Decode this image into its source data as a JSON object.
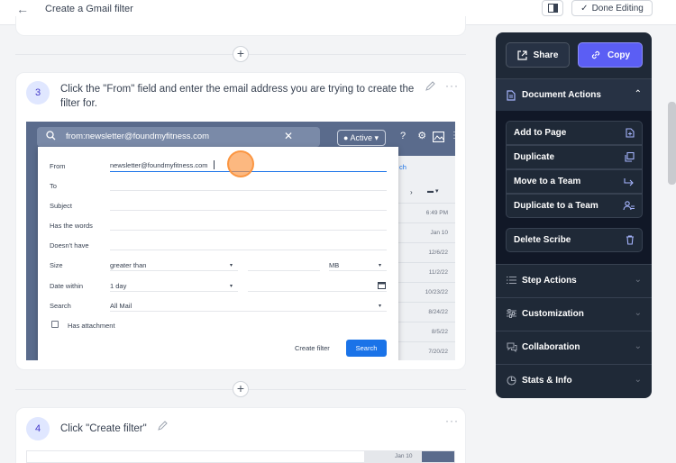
{
  "header": {
    "back_icon": "arrow-left-icon",
    "title": "Create a Gmail filter",
    "done_label": "Done Editing"
  },
  "steps": [
    {
      "number": "3",
      "text": "Click the \"From\" field and enter the email address you are trying to create the filter for.",
      "screenshot": {
        "search_query": "from:newsletter@foundmyfitness.com",
        "active_label": "Active",
        "filter": {
          "rows": [
            {
              "label": "From",
              "value": "newsletter@foundmyfitness.com"
            },
            {
              "label": "To",
              "value": ""
            },
            {
              "label": "Subject",
              "value": ""
            },
            {
              "label": "Has the words",
              "value": ""
            },
            {
              "label": "Doesn't have",
              "value": ""
            },
            {
              "label": "Size",
              "value": "greater than",
              "unit": "MB"
            },
            {
              "label": "Date within",
              "value": "1 day"
            },
            {
              "label": "Search",
              "value": "All Mail"
            }
          ],
          "attachment_label": "Has attachment",
          "create_filter_label": "Create filter",
          "search_button_label": "Search"
        },
        "mail_dates": [
          "6:49 PM",
          "Jan 10",
          "12/6/22",
          "11/2/22",
          "10/23/22",
          "8/24/22",
          "8/5/22",
          "7/20/22"
        ],
        "partial_text": "ch"
      }
    },
    {
      "number": "4",
      "text": "Click \"Create filter\"",
      "screenshot": {
        "mail_date": "Jan 10"
      }
    }
  ],
  "panel": {
    "share_label": "Share",
    "copy_label": "Copy",
    "document_actions": {
      "title": "Document Actions",
      "items": [
        {
          "label": "Add to Page",
          "icon": "add-page-icon"
        },
        {
          "label": "Duplicate",
          "icon": "duplicate-icon"
        },
        {
          "label": "Move to a Team",
          "icon": "move-arrow-icon"
        },
        {
          "label": "Duplicate to a Team",
          "icon": "team-icon"
        }
      ],
      "delete_label": "Delete Scribe"
    },
    "sections": [
      {
        "label": "Step Actions",
        "icon": "list-icon"
      },
      {
        "label": "Customization",
        "icon": "sliders-icon"
      },
      {
        "label": "Collaboration",
        "icon": "chat-icon"
      },
      {
        "label": "Stats & Info",
        "icon": "pie-chart-icon"
      }
    ]
  }
}
